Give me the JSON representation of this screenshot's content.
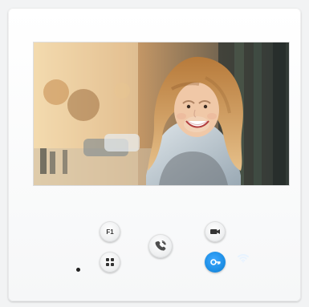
{
  "device": {
    "brand_text": "",
    "screen": {
      "content": "video-feed"
    },
    "buttons": {
      "f1": {
        "label": "F1",
        "icon": "f1-icon"
      },
      "menu": {
        "icon": "grid-icon"
      },
      "answer": {
        "icon": "handset-speech-icon"
      },
      "camera": {
        "icon": "camera-icon"
      },
      "door": {
        "icon": "key-icon"
      }
    },
    "indicators": {
      "led": {
        "icon": "led-dot"
      },
      "wifi": {
        "icon": "wifi-icon"
      }
    },
    "colors": {
      "panel": "#ffffff",
      "accent": "#1e8fe6",
      "wifi": "#e8f3ff"
    }
  }
}
